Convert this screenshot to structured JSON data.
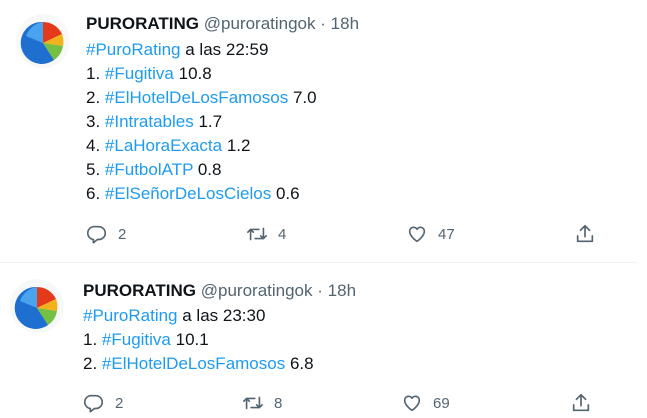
{
  "tweets": [
    {
      "display_name": "PURORATING",
      "handle": "@puroratingok",
      "separator": "·",
      "time": "18h",
      "intro_tag": "#PuroRating",
      "intro_text": " a las 22:59",
      "items": [
        {
          "num": "1. ",
          "tag": "#Fugitiva",
          "value": " 10.8"
        },
        {
          "num": "2. ",
          "tag": "#ElHotelDeLosFamosos",
          "value": " 7.0"
        },
        {
          "num": "3. ",
          "tag": "#Intratables",
          "value": " 1.7"
        },
        {
          "num": "4. ",
          "tag": "#LaHoraExacta",
          "value": " 1.2"
        },
        {
          "num": "5. ",
          "tag": "#FutbolATP",
          "value": " 0.8"
        },
        {
          "num": "6. ",
          "tag": "#ElSeñorDeLosCielos",
          "value": " 0.6"
        }
      ],
      "replies": "2",
      "retweets": "4",
      "likes": "47"
    },
    {
      "display_name": "PURORATING",
      "handle": "@puroratingok",
      "separator": "·",
      "time": "18h",
      "intro_tag": "#PuroRating",
      "intro_text": " a las 23:30",
      "items": [
        {
          "num": "1. ",
          "tag": "#Fugitiva",
          "value": " 10.1"
        },
        {
          "num": "2. ",
          "tag": "#ElHotelDeLosFamosos",
          "value": " 6.8"
        }
      ],
      "replies": "2",
      "retweets": "8",
      "likes": "69"
    }
  ],
  "icons": {
    "reply": "reply-icon",
    "retweet": "retweet-icon",
    "like": "heart-icon",
    "share": "share-icon",
    "avatar": "pie-chart-logo"
  },
  "colors": {
    "link": "#1d9bf0",
    "secondary_text": "#536471",
    "primary_text": "#0f1419",
    "divider": "#eff3f4"
  }
}
